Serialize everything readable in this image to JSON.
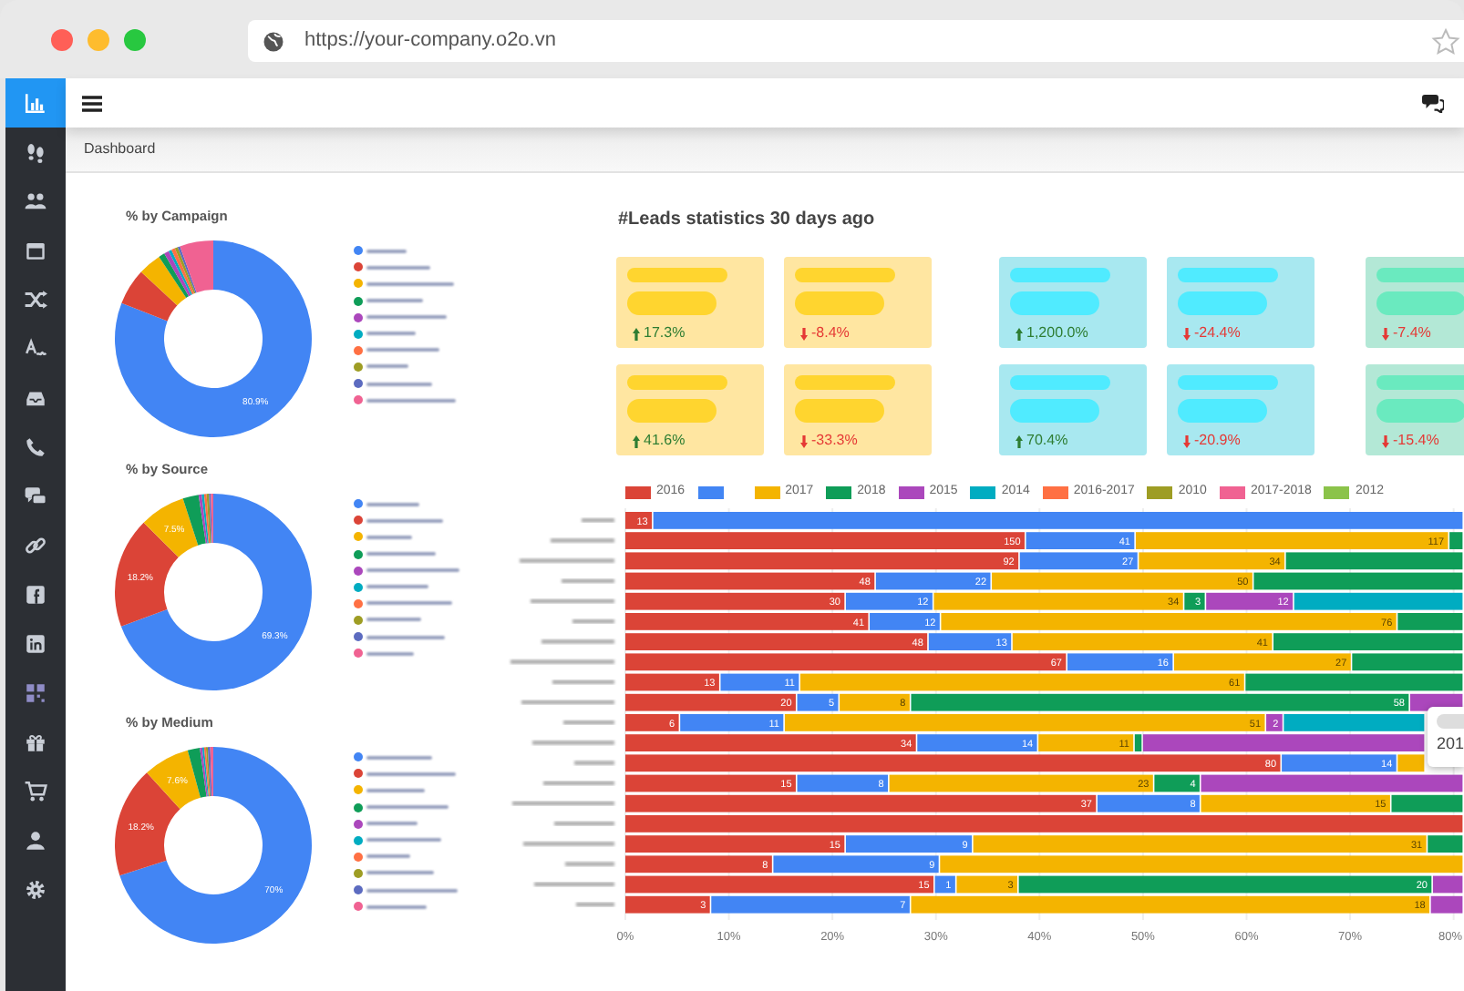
{
  "browser": {
    "url": "https://your-company.o2o.vn"
  },
  "sidebar": {
    "items": [
      {
        "selected": true
      },
      {
        "selected": false
      },
      {
        "selected": false
      },
      {
        "selected": false
      },
      {
        "selected": false
      },
      {
        "selected": false
      },
      {
        "selected": false
      },
      {
        "selected": false
      },
      {
        "selected": false
      },
      {
        "selected": false
      },
      {
        "selected": false
      },
      {
        "selected": false
      },
      {
        "selected": false
      },
      {
        "selected": false
      },
      {
        "selected": false
      },
      {
        "selected": false
      },
      {
        "selected": false
      }
    ]
  },
  "breadcrumb": "Dashboard",
  "donuts": [
    {
      "legend": [
        {
          "color": "#4285f4"
        },
        {
          "color": "#db4437"
        },
        {
          "color": "#f4b400"
        },
        {
          "color": "#0f9d58"
        },
        {
          "color": "#ab47bc"
        },
        {
          "color": "#00acc1"
        },
        {
          "color": "#ff7043"
        },
        {
          "color": "#9e9d24"
        },
        {
          "color": "#5c6bc0"
        },
        {
          "color": "#f06292"
        }
      ],
      "chart_data": {
        "type": "donut",
        "title": "% by Campaign",
        "values": [
          80.9,
          6.0,
          3.8,
          1.0,
          0.8,
          0.5,
          0.6,
          0.5,
          0.4,
          5.5
        ],
        "value_labels": [
          "80.9%",
          null,
          null,
          null,
          null,
          null,
          null,
          null,
          null,
          null
        ]
      }
    },
    {
      "legend": [
        {
          "color": "#4285f4"
        },
        {
          "color": "#db4437"
        },
        {
          "color": "#f4b400"
        },
        {
          "color": "#0f9d58"
        },
        {
          "color": "#ab47bc"
        },
        {
          "color": "#00acc1"
        },
        {
          "color": "#ff7043"
        },
        {
          "color": "#9e9d24"
        },
        {
          "color": "#5c6bc0"
        },
        {
          "color": "#f06292"
        }
      ],
      "chart_data": {
        "type": "donut",
        "title": "% by Source",
        "values": [
          69.3,
          18.2,
          7.5,
          2.6,
          0.5,
          0.4,
          0.4,
          0.4,
          0.3,
          0.4
        ],
        "value_labels": [
          "69.3%",
          "18.2%",
          "7.5%",
          null,
          null,
          null,
          null,
          null,
          null,
          null
        ]
      }
    },
    {
      "legend": [
        {
          "color": "#4285f4"
        },
        {
          "color": "#db4437"
        },
        {
          "color": "#f4b400"
        },
        {
          "color": "#0f9d58"
        },
        {
          "color": "#ab47bc"
        },
        {
          "color": "#00acc1"
        },
        {
          "color": "#ff7043"
        },
        {
          "color": "#9e9d24"
        },
        {
          "color": "#5c6bc0"
        },
        {
          "color": "#f06292"
        }
      ],
      "chart_data": {
        "type": "donut",
        "title": "% by Medium",
        "values": [
          70.0,
          18.2,
          7.6,
          2.0,
          0.4,
          0.3,
          0.3,
          0.3,
          0.4,
          0.5
        ],
        "value_labels": [
          "70%",
          "18.2%",
          "7.6%",
          null,
          null,
          null,
          null,
          null,
          null,
          null
        ]
      }
    }
  ],
  "stats": {
    "title": "#Leads statistics 30 days ago",
    "cards": [
      {
        "color": "#ffe6a1",
        "rising": true,
        "change": "17.3%"
      },
      {
        "color": "#ffe6a1",
        "rising": false,
        "change": "-8.4%"
      },
      {
        "color": "#a8e8f0",
        "rising": true,
        "change": "1,200.0%"
      },
      {
        "color": "#a8e8f0",
        "rising": false,
        "change": "-24.4%"
      },
      {
        "color": "#b3e8d6",
        "rising": false,
        "change": "-7.4%"
      },
      {
        "color": "#ffe6a1",
        "rising": true,
        "change": "41.6%"
      },
      {
        "color": "#ffe6a1",
        "rising": false,
        "change": "-33.3%"
      },
      {
        "color": "#a8e8f0",
        "rising": true,
        "change": "70.4%"
      },
      {
        "color": "#a8e8f0",
        "rising": false,
        "change": "-20.9%"
      },
      {
        "color": "#b3e8d6",
        "rising": false,
        "change": "-15.4%"
      }
    ]
  },
  "bar_chart": {
    "chart_data": {
      "type": "bar",
      "orientation": "horizontal",
      "stacked": true,
      "grid": true,
      "xlim": [
        0,
        81
      ],
      "xticks": [
        {
          "value": 0,
          "label": "0%"
        },
        {
          "value": 10,
          "label": "10%"
        },
        {
          "value": 20,
          "label": "20%"
        },
        {
          "value": 30,
          "label": "30%"
        },
        {
          "value": 40,
          "label": "40%"
        },
        {
          "value": 50,
          "label": "50%"
        },
        {
          "value": 60,
          "label": "60%"
        },
        {
          "value": 70,
          "label": "70%"
        },
        {
          "value": 80,
          "label": "80%"
        }
      ],
      "series": [
        {
          "name": "2016",
          "color": "#db4437",
          "values": [
            2.7,
            38.7,
            38.1,
            24.2,
            21.3,
            23.6,
            29.3,
            42.7,
            9.2,
            16.6,
            5.3,
            28.2,
            63.4,
            16.6,
            45.6,
            81,
            21.3,
            14.3,
            29.9,
            8.3
          ]
        },
        {
          "color": "#4285f4",
          "values": [
            78.3,
            10.6,
            11.5,
            11.2,
            8.5,
            6.9,
            8.1,
            10.3,
            7.7,
            4.1,
            10.1,
            11.7,
            11.2,
            8.9,
            10.0,
            null,
            12.3,
            16.1,
            2.1,
            19.3
          ]
        },
        {
          "name": "2017",
          "color": "#f4b400",
          "values": [
            null,
            30.3,
            14.2,
            25.3,
            24.2,
            44.1,
            25.2,
            17.2,
            43.0,
            6.9,
            46.5,
            9.3,
            2.7,
            25.6,
            18.4,
            null,
            43.9,
            50.6,
            6.0,
            50.2
          ]
        },
        {
          "name": "2018",
          "color": "#0f9d58",
          "values": [
            null,
            1.4,
            17.2,
            20.3,
            2.1,
            6.4,
            18.4,
            10.8,
            21.1,
            48.2,
            null,
            0.8,
            null,
            4.5,
            7.0,
            null,
            3.5,
            null,
            40.0,
            null
          ]
        },
        {
          "name": "2015",
          "color": "#ab47bc",
          "values": [
            null,
            null,
            null,
            null,
            8.5,
            null,
            null,
            null,
            null,
            5.2,
            1.7,
            27.3,
            null,
            25.4,
            null,
            null,
            null,
            null,
            3.0,
            3.2
          ]
        },
        {
          "name": "2014",
          "color": "#00acc1",
          "values": [
            null,
            null,
            null,
            null,
            16.4,
            null,
            null,
            null,
            null,
            null,
            13.7,
            null,
            null,
            null,
            null,
            null,
            null,
            null,
            null,
            null
          ]
        },
        {
          "name": "2016-2017",
          "color": "#ff7043",
          "values": [
            null,
            null,
            null,
            null,
            null,
            null,
            null,
            null,
            null,
            null,
            null,
            null,
            null,
            null,
            null,
            null,
            null,
            null,
            null,
            null
          ]
        },
        {
          "name": "2010",
          "color": "#9e9d24",
          "values": [
            null,
            null,
            null,
            null,
            null,
            null,
            null,
            null,
            null,
            null,
            null,
            null,
            null,
            null,
            null,
            null,
            null,
            null,
            null,
            null
          ]
        },
        {
          "name": "2017-2018",
          "color": "#f06292",
          "values": [
            null,
            null,
            null,
            null,
            null,
            null,
            null,
            null,
            null,
            null,
            null,
            null,
            null,
            null,
            null,
            null,
            null,
            null,
            null,
            null
          ]
        },
        {
          "name": "2012",
          "color": "#8bc34a",
          "values": [
            null,
            null,
            null,
            null,
            null,
            null,
            null,
            null,
            null,
            null,
            null,
            null,
            null,
            null,
            null,
            null,
            null,
            null,
            null,
            null
          ]
        }
      ],
      "value_labels": [
        [
          "13",
          "150",
          "92",
          "48",
          "30",
          "41",
          "48",
          "67",
          "13",
          "20",
          "6",
          "34",
          "80",
          "15",
          "37",
          null,
          "15",
          "8",
          "15",
          "3"
        ],
        [
          null,
          "41",
          "27",
          "22",
          "12",
          "12",
          "13",
          "16",
          "11",
          "5",
          "11",
          "14",
          "14",
          "8",
          "8",
          null,
          "9",
          "9",
          "1",
          "7"
        ],
        [
          null,
          "117",
          "34",
          "50",
          "34",
          "76",
          "41",
          "27",
          "61",
          "8",
          "51",
          "11",
          null,
          "23",
          "15",
          null,
          "31",
          null,
          "3",
          "18"
        ],
        [
          null,
          null,
          null,
          null,
          "3",
          null,
          null,
          null,
          null,
          "58",
          null,
          null,
          null,
          "4",
          null,
          null,
          null,
          null,
          "20",
          null
        ],
        [
          null,
          null,
          null,
          null,
          "12",
          null,
          null,
          null,
          null,
          null,
          "2",
          null,
          null,
          null,
          null,
          null,
          null,
          null,
          null,
          null
        ],
        [
          null,
          null,
          null,
          null,
          null,
          null,
          null,
          null,
          null,
          null,
          null,
          null,
          null,
          null,
          null,
          null,
          null,
          null,
          null,
          null
        ],
        [
          null,
          null,
          null,
          null,
          null,
          null,
          null,
          null,
          null,
          null,
          null,
          null,
          null,
          null,
          null,
          null,
          null,
          null,
          null,
          null
        ],
        [
          null,
          null,
          null,
          null,
          null,
          null,
          null,
          null,
          null,
          null,
          null,
          null,
          null,
          null,
          null,
          null,
          null,
          null,
          null,
          null
        ],
        [
          null,
          null,
          null,
          null,
          null,
          null,
          null,
          null,
          null,
          null,
          null,
          null,
          null,
          null,
          null,
          null,
          null,
          null,
          null,
          null
        ],
        [
          null,
          null,
          null,
          null,
          null,
          null,
          null,
          null,
          null,
          null,
          null,
          null,
          null,
          null,
          null,
          null,
          null,
          null,
          null,
          null
        ]
      ]
    },
    "tooltip": {
      "text": "201"
    }
  }
}
